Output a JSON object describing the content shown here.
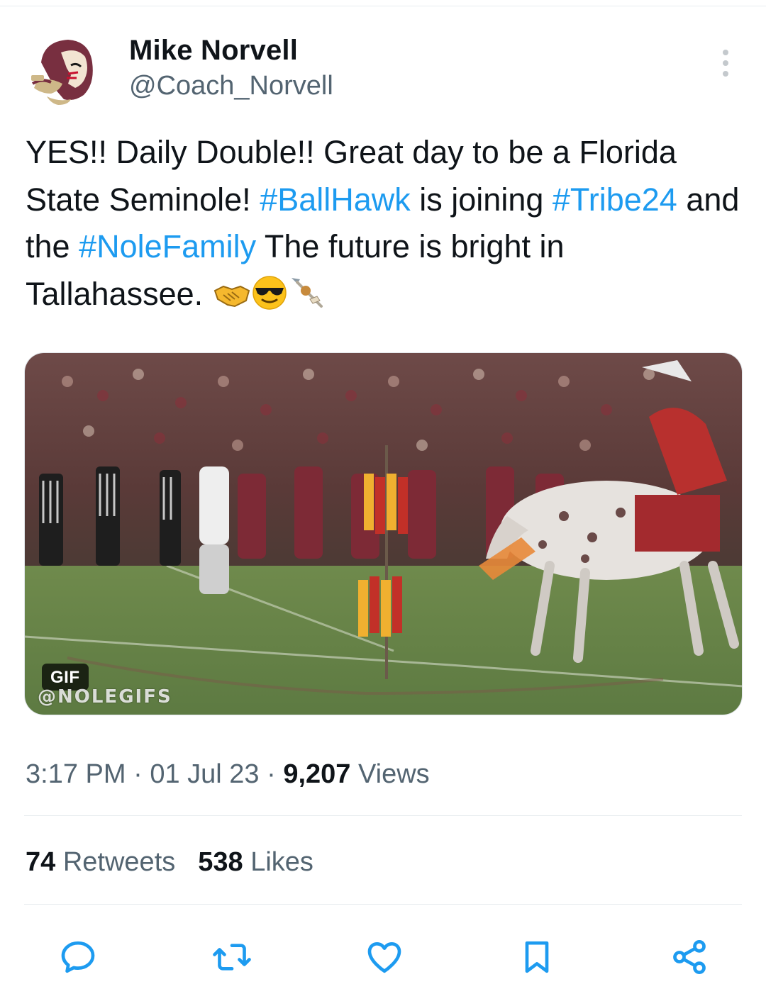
{
  "author": {
    "display_name": "Mike Norvell",
    "handle": "@Coach_Norvell",
    "avatar_icon": "seminole-logo"
  },
  "tweet": {
    "segments": [
      {
        "text": "YES!! Daily Double!! Great day to be a Florida State Seminole! ",
        "type": "text"
      },
      {
        "text": "#BallHawk",
        "type": "hashtag"
      },
      {
        "text": " is joining ",
        "type": "text"
      },
      {
        "text": "#Tribe24",
        "type": "hashtag"
      },
      {
        "text": " and the ",
        "type": "text"
      },
      {
        "text": "#NoleFamily",
        "type": "hashtag"
      },
      {
        "text": " The future is bright in Tallahassee. ",
        "type": "text"
      }
    ],
    "emojis": [
      "handshake",
      "smiling-face-with-sunglasses",
      "spear"
    ]
  },
  "media": {
    "badge": "GIF",
    "watermark": "@NOLEGIFS"
  },
  "meta": {
    "time": "3:17 PM",
    "separator": "·",
    "date": "01 Jul 23",
    "views_count": "9,207",
    "views_label": "Views"
  },
  "stats": {
    "retweets_count": "74",
    "retweets_label": "Retweets",
    "likes_count": "538",
    "likes_label": "Likes"
  },
  "actions": [
    "reply-icon",
    "retweet-icon",
    "like-icon",
    "bookmark-icon",
    "share-icon"
  ],
  "colors": {
    "text": "#0f1419",
    "secondary": "#536471",
    "link": "#1d9bf0",
    "divider": "#e7ecef"
  }
}
